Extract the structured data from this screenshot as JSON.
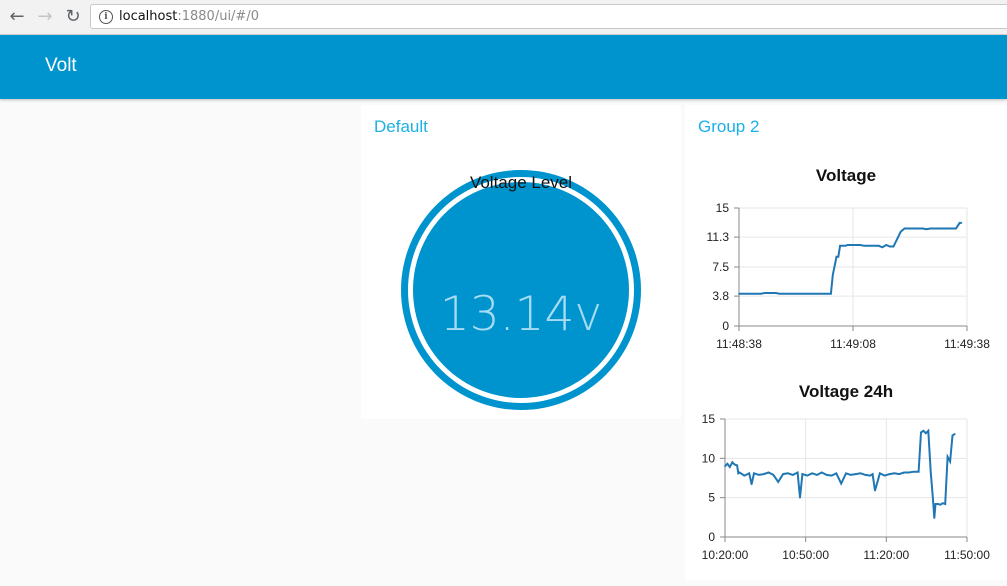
{
  "browser": {
    "url_host": "localhost",
    "url_path": ":1880/ui/#/0"
  },
  "dashboard": {
    "title": "Volt",
    "header_color": "#0094ce"
  },
  "groups": [
    {
      "title": "Default",
      "gauge": {
        "label": "Voltage Level",
        "value_text": "13.14v",
        "value": 13.14,
        "color": "#0094ce"
      }
    },
    {
      "title": "Group 2",
      "charts": [
        {
          "title": "Voltage"
        },
        {
          "title": "Voltage 24h"
        }
      ]
    }
  ],
  "chart_data": [
    {
      "type": "line",
      "title": "Voltage",
      "line_color": "#1f77b4",
      "y_ticks": [
        "15",
        "11.3",
        "7.5",
        "3.8",
        "0"
      ],
      "y_tick_values": [
        15,
        11.3,
        7.5,
        3.8,
        0
      ],
      "x_ticks": [
        "11:48:38",
        "11:49:08",
        "11:49:38"
      ],
      "ylim": [
        0,
        15
      ],
      "xlim_seconds": [
        0,
        62
      ],
      "x_seconds": [
        0,
        6,
        7,
        10,
        11,
        12,
        25,
        25.5,
        26.5,
        27,
        27.5,
        29,
        29.5,
        33,
        34,
        38,
        39,
        40,
        41,
        42,
        44,
        45,
        50,
        51,
        52,
        59,
        60,
        60.5
      ],
      "y": [
        4.1,
        4.1,
        4.2,
        4.2,
        4.1,
        4.1,
        4.1,
        6.5,
        8.8,
        8.8,
        10.2,
        10.2,
        10.3,
        10.3,
        10.2,
        10.2,
        10.0,
        10.3,
        10.1,
        10.1,
        12.0,
        12.4,
        12.4,
        12.3,
        12.4,
        12.4,
        13.1,
        13.1
      ],
      "grid": true
    },
    {
      "type": "line",
      "title": "Voltage 24h",
      "line_color": "#1f77b4",
      "y_ticks": [
        "15",
        "10",
        "5",
        "0"
      ],
      "y_tick_values": [
        15,
        10,
        5,
        0
      ],
      "x_ticks": [
        "10:20:00",
        "10:50:00",
        "11:20:00",
        "11:50:00"
      ],
      "ylim": [
        0,
        15
      ],
      "xlim_minutes": [
        0,
        100
      ],
      "x_minutes": [
        0,
        1,
        2,
        3,
        4,
        5,
        5.5,
        6,
        8,
        10,
        11,
        12,
        14,
        16,
        18,
        20,
        22,
        24,
        26,
        28,
        30,
        31,
        32,
        34,
        36,
        38,
        40,
        42,
        44,
        46,
        48,
        50,
        52,
        54,
        56,
        58,
        60,
        61,
        62,
        64,
        66,
        68,
        70,
        72,
        74,
        76,
        78,
        80,
        81,
        82,
        83,
        84,
        85,
        86,
        86.5,
        87,
        88,
        89,
        90,
        91,
        92,
        93,
        94,
        95
      ],
      "y": [
        9.0,
        9.3,
        8.9,
        9.5,
        9.2,
        9.1,
        8.1,
        8.2,
        7.8,
        8.1,
        6.7,
        8.1,
        7.9,
        8.0,
        8.2,
        7.9,
        7.0,
        8.0,
        8.1,
        7.9,
        8.2,
        5.0,
        8.0,
        7.8,
        8.1,
        7.9,
        8.2,
        7.9,
        7.8,
        8.1,
        6.8,
        8.1,
        7.9,
        8.0,
        8.1,
        7.9,
        7.8,
        8.0,
        5.9,
        8.1,
        7.8,
        8.0,
        8.1,
        8.0,
        8.2,
        8.2,
        8.3,
        8.3,
        13.3,
        13.5,
        13.2,
        13.5,
        8.3,
        4.6,
        2.4,
        4.2,
        4.2,
        4.1,
        4.3,
        4.2,
        10.2,
        9.6,
        12.9,
        13.1
      ],
      "grid": true
    }
  ]
}
